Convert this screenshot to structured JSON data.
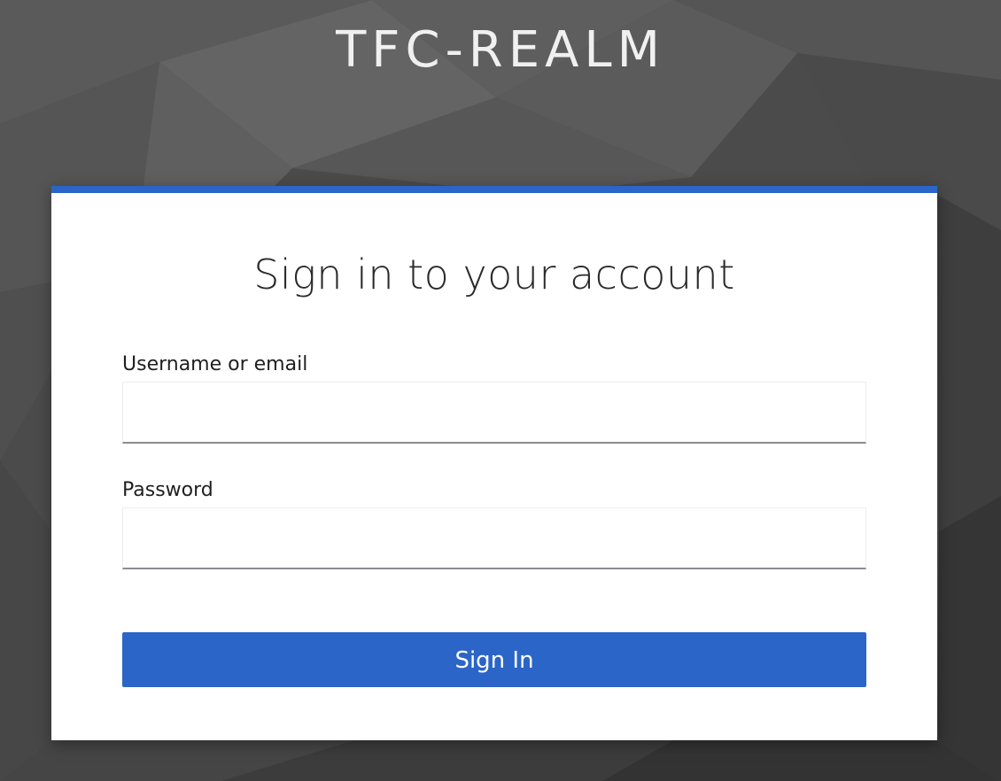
{
  "realm": {
    "title": "TFC-REALM"
  },
  "login": {
    "heading": "Sign in to your account",
    "username_label": "Username or email",
    "username_value": "",
    "password_label": "Password",
    "password_value": "",
    "submit_label": "Sign In"
  },
  "colors": {
    "accent": "#2b65c7",
    "background": "#4a4a4a",
    "card": "#ffffff"
  }
}
